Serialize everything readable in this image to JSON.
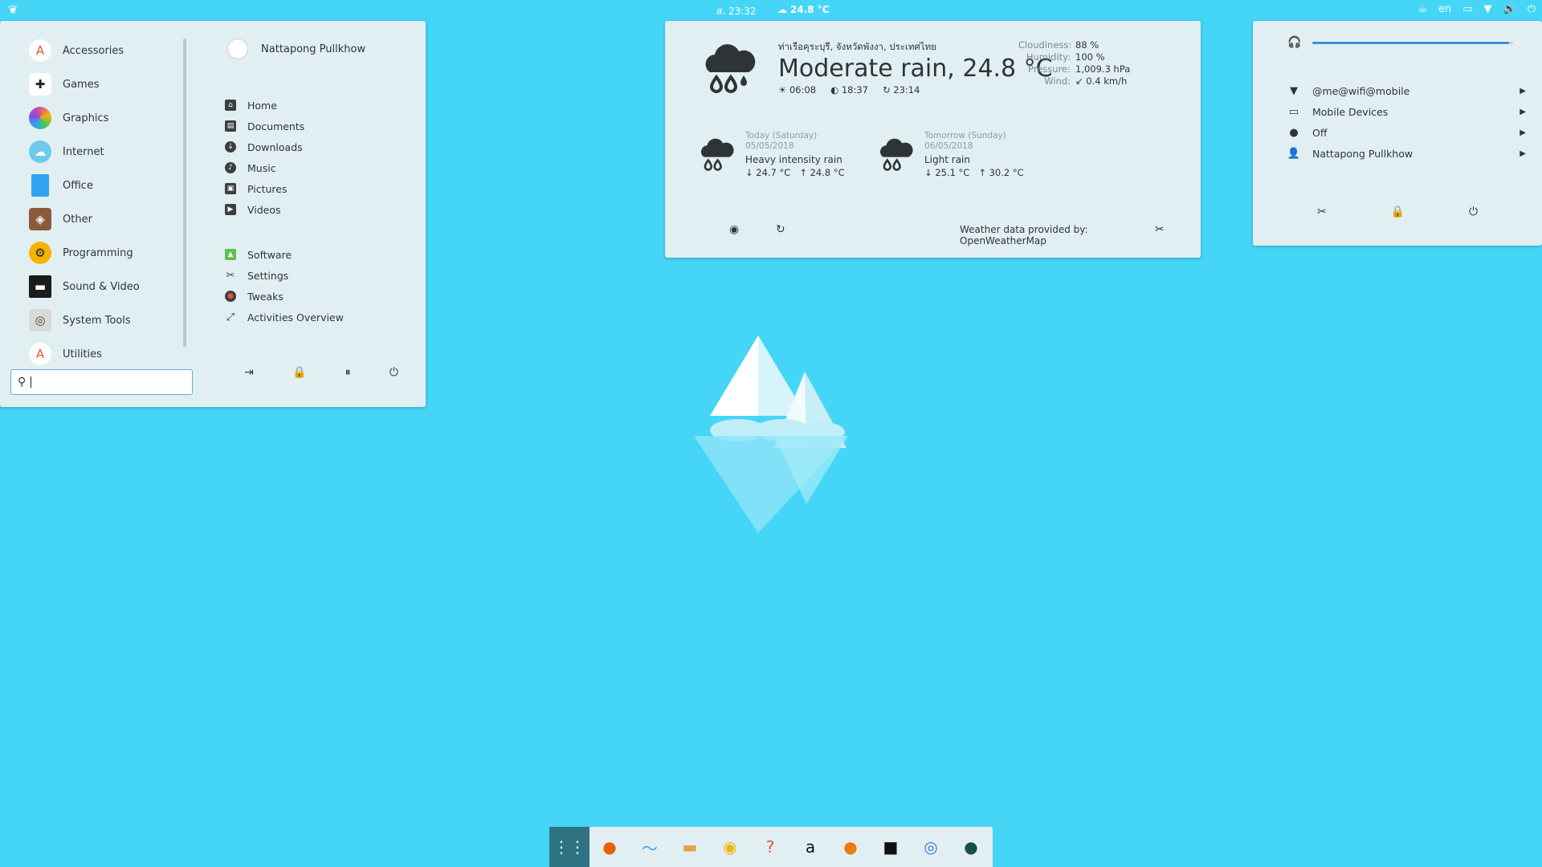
{
  "topbar": {
    "clock": "ส. 23:32",
    "weather_temp": "24.8 °C",
    "keyboard_layout": "en"
  },
  "menu": {
    "categories": [
      {
        "label": "Accessories",
        "icon": "accessories-icon",
        "color": "#ffffff"
      },
      {
        "label": "Games",
        "icon": "games-icon",
        "color": "#ffffff"
      },
      {
        "label": "Graphics",
        "icon": "graphics-icon",
        "color": "#e04d9a"
      },
      {
        "label": "Internet",
        "icon": "internet-icon",
        "color": "#6ec8ef"
      },
      {
        "label": "Office",
        "icon": "office-icon",
        "color": "#2fa3f0"
      },
      {
        "label": "Other",
        "icon": "other-icon",
        "color": "#8b5a3c"
      },
      {
        "label": "Programming",
        "icon": "programming-icon",
        "color": "#f5b400"
      },
      {
        "label": "Sound & Video",
        "icon": "sound-video-icon",
        "color": "#1b1b1b"
      },
      {
        "label": "System Tools",
        "icon": "system-tools-icon",
        "color": "#d9d9d9"
      },
      {
        "label": "Utilities",
        "icon": "utilities-icon",
        "color": "#ffffff"
      }
    ],
    "search_value": "",
    "user_name": "Nattapong Pullkhow",
    "places": [
      {
        "label": "Home",
        "icon": "home-icon"
      },
      {
        "label": "Documents",
        "icon": "documents-icon"
      },
      {
        "label": "Downloads",
        "icon": "downloads-icon"
      },
      {
        "label": "Music",
        "icon": "music-icon"
      },
      {
        "label": "Pictures",
        "icon": "pictures-icon"
      },
      {
        "label": "Videos",
        "icon": "videos-icon"
      }
    ],
    "tools": [
      {
        "label": "Software",
        "icon": "software-icon"
      },
      {
        "label": "Settings",
        "icon": "settings-icon"
      },
      {
        "label": "Tweaks",
        "icon": "tweaks-icon"
      },
      {
        "label": "Activities Overview",
        "icon": "activities-icon"
      }
    ]
  },
  "weather": {
    "location": "ท่าเรือคุระบุรี, จังหวัดพังงา, ประเทศไทย",
    "condition": "Moderate rain, 24.8 °C",
    "sunrise": "06:08",
    "sunset": "18:37",
    "updated": "23:14",
    "details": [
      {
        "k": "Cloudiness:",
        "v": "88 %"
      },
      {
        "k": "Humidity:",
        "v": "100 %"
      },
      {
        "k": "Pressure:",
        "v": "1,009.3 hPa"
      },
      {
        "k": "Wind:",
        "v": "↙ 0.4 km/h"
      }
    ],
    "forecast": [
      {
        "day": "Today (Saturday)",
        "date": "05/05/2018",
        "desc": "Heavy intensity rain",
        "low": "↓ 24.7 °C",
        "high": "↑ 24.8 °C"
      },
      {
        "day": "Tomorrow (Sunday)",
        "date": "06/05/2018",
        "desc": "Light rain",
        "low": "↓ 25.1 °C",
        "high": "↑ 30.2 °C"
      }
    ],
    "provider_prefix": "Weather data provided by:",
    "provider": "OpenWeatherMap"
  },
  "system": {
    "volume_level": 0.98,
    "items": [
      {
        "label": "@me@wifi@mobile",
        "icon": "wifi-icon"
      },
      {
        "label": "Mobile Devices",
        "icon": "mobile-devices-icon"
      },
      {
        "label": "Off",
        "icon": "bluetooth-icon"
      },
      {
        "label": "Nattapong Pullkhow",
        "icon": "user-icon"
      }
    ]
  },
  "dock": {
    "apps": [
      "app-grid-icon",
      "firefox-icon",
      "krita-icon",
      "files-icon",
      "rhythmbox-icon",
      "help-icon",
      "amazon-icon",
      "blender-icon",
      "terminal-icon",
      "chromium-icon",
      "inkscape-icon"
    ]
  },
  "colors": {
    "desktop": "#45d6f7",
    "panel": "#e1eff3",
    "accent": "#3d8fe0"
  }
}
